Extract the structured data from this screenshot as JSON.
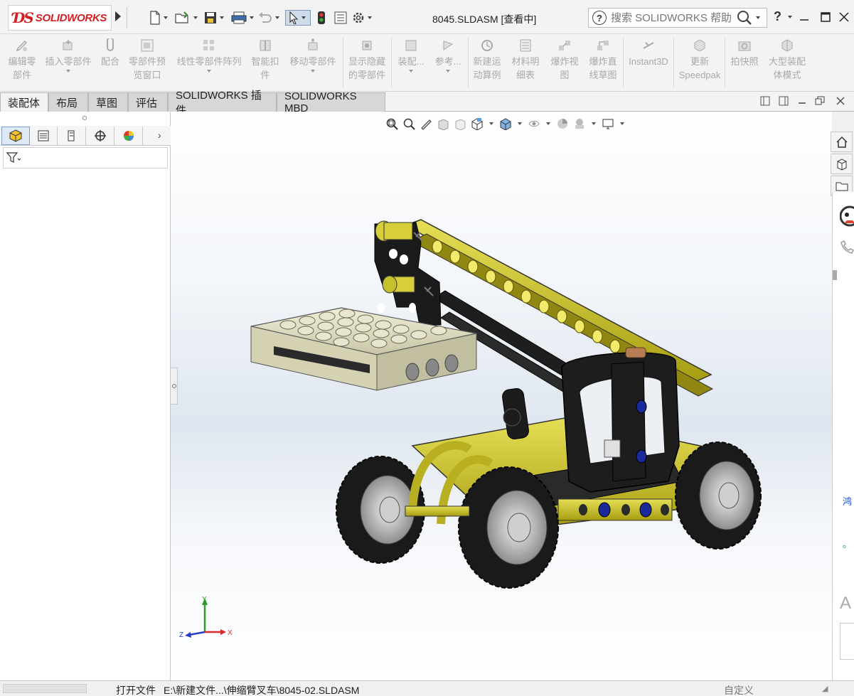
{
  "app": {
    "logo_text": "SOLIDWORKS",
    "document_title": "8045.SLDASM [查看中]"
  },
  "search": {
    "placeholder": "搜索 SOLIDWORKS 帮助"
  },
  "help": {
    "label": "?"
  },
  "ribbon": {
    "items": [
      {
        "label": "编辑零\n部件",
        "icon": "edit-component-icon"
      },
      {
        "label": "插入零部件",
        "icon": "insert-component-icon"
      },
      {
        "label": "配合",
        "icon": "mate-icon"
      },
      {
        "label": "零部件预\n览窗口",
        "icon": "preview-window-icon"
      },
      {
        "label": "线性零部件阵列",
        "icon": "linear-pattern-icon"
      },
      {
        "label": "智能扣\n件",
        "icon": "smart-fastener-icon"
      },
      {
        "label": "移动零部件",
        "icon": "move-component-icon"
      },
      {
        "label": "显示隐藏\n的零部件",
        "icon": "show-hidden-icon"
      },
      {
        "label": "装配...",
        "icon": "assembly-features-icon"
      },
      {
        "label": "参考...",
        "icon": "reference-geometry-icon"
      },
      {
        "label": "新建运\n动算例",
        "icon": "motion-study-icon"
      },
      {
        "label": "材料明\n细表",
        "icon": "bom-icon"
      },
      {
        "label": "爆炸视\n图",
        "icon": "exploded-view-icon"
      },
      {
        "label": "爆炸直\n线草图",
        "icon": "explode-line-sketch-icon"
      },
      {
        "label": "Instant3D",
        "icon": "instant3d-icon"
      },
      {
        "label": "更新\nSpeedpak",
        "icon": "speedpak-icon"
      },
      {
        "label": "拍快照",
        "icon": "snapshot-icon"
      },
      {
        "label": "大型装配\n体模式",
        "icon": "large-assembly-icon"
      }
    ]
  },
  "tabs": [
    {
      "label": "装配体"
    },
    {
      "label": "布局"
    },
    {
      "label": "草图"
    },
    {
      "label": "评估"
    },
    {
      "label": "SOLIDWORKS 插件"
    },
    {
      "label": "SOLIDWORKS MBD"
    }
  ],
  "right_strip": {
    "snippet1": "鸿",
    "snippet2": "。",
    "snippet3": "A"
  },
  "triad": {
    "x": "X",
    "y": "Y",
    "z": "Z"
  },
  "status": {
    "label": "打开文件",
    "path": "E:\\新建文件...\\伸缩臂叉车\\8045-02.SLDASM",
    "custom": "自定义"
  },
  "colors": {
    "accent_red": "#d41f26",
    "model_yellow": "#c9c12a",
    "model_black": "#1a1a1a",
    "viewport_gradient": "#dfe6ef"
  }
}
